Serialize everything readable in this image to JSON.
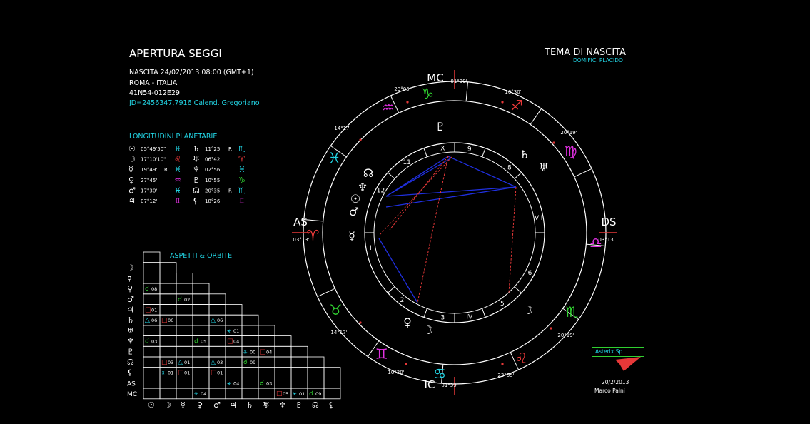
{
  "header": {
    "title": "APERTURA SEGGI",
    "birth_line": "NASCITA 24/02/2013 08:00 (GMT+1)",
    "place": "ROMA - ITALIA",
    "coords": "41N54-012E29",
    "jd_line": "JD=2456347,7916  Calend. Gregoriano"
  },
  "chart_header": {
    "title": "TEMA DI NASCITA",
    "subtitle": "DOMIFIC. PLACIDO"
  },
  "longitudes": {
    "title": "LONGITUDINI PLANETARIE",
    "left": [
      {
        "planet": "☉",
        "value": "05°49'50\"",
        "r": "",
        "sign": "♓",
        "color": "#22d6e6"
      },
      {
        "planet": "☽",
        "value": "17°10'10\"",
        "r": "",
        "sign": "♌",
        "color": "#e63838"
      },
      {
        "planet": "☿",
        "value": "19°49'",
        "r": "R",
        "sign": "♓",
        "color": "#22d6e6"
      },
      {
        "planet": "♀",
        "value": "27°45'",
        "r": "",
        "sign": "♒",
        "color": "#e030e0"
      },
      {
        "planet": "♂",
        "value": "17°30'",
        "r": "",
        "sign": "♓",
        "color": "#22d6e6"
      },
      {
        "planet": "♃",
        "value": "07°12'",
        "r": "",
        "sign": "♊",
        "color": "#e030e0"
      }
    ],
    "right": [
      {
        "planet": "♄",
        "value": "11°25'",
        "r": "R",
        "sign": "♏",
        "color": "#22d6e6"
      },
      {
        "planet": "♅",
        "value": "06°42'",
        "r": "",
        "sign": "♈",
        "color": "#e63838"
      },
      {
        "planet": "♆",
        "value": "02°56'",
        "r": "",
        "sign": "♓",
        "color": "#22d6e6"
      },
      {
        "planet": "♇",
        "value": "10°55'",
        "r": "",
        "sign": "♑",
        "color": "#30d030"
      },
      {
        "planet": "☊",
        "value": "20°35'",
        "r": "R",
        "sign": "♏",
        "color": "#22d6e6"
      },
      {
        "planet": "⚸",
        "value": "18°26'",
        "r": "",
        "sign": "♊",
        "color": "#e030e0"
      }
    ]
  },
  "aspects": {
    "title": "ASPETTI  &  ORBITE",
    "row_labels": [
      "☽",
      "☿",
      "♀",
      "♂",
      "♃",
      "♄",
      "♅",
      "♆",
      "♇",
      "☊",
      "⚸",
      "AS",
      "MC"
    ],
    "col_labels": [
      "☉",
      "☽",
      "☿",
      "♀",
      "♂",
      "♃",
      "♄",
      "♅",
      "♆",
      "♇",
      "☊",
      "⚸"
    ],
    "cells": [
      {
        "r": 3,
        "c": 0,
        "sym": "☌",
        "orb": "08",
        "color": "#30d030"
      },
      {
        "r": 4,
        "c": 2,
        "sym": "☌",
        "orb": "02",
        "color": "#30d030"
      },
      {
        "r": 5,
        "c": 0,
        "sym": "□",
        "orb": "01",
        "color": "#e63838"
      },
      {
        "r": 6,
        "c": 0,
        "sym": "△",
        "orb": "06",
        "color": "#22d6e6"
      },
      {
        "r": 6,
        "c": 1,
        "sym": "□",
        "orb": "06",
        "color": "#e63838"
      },
      {
        "r": 6,
        "c": 4,
        "sym": "△",
        "orb": "06",
        "color": "#22d6e6"
      },
      {
        "r": 7,
        "c": 5,
        "sym": "⚹",
        "orb": "01",
        "color": "#22d6e6"
      },
      {
        "r": 8,
        "c": 0,
        "sym": "☌",
        "orb": "03",
        "color": "#30d030"
      },
      {
        "r": 8,
        "c": 3,
        "sym": "☌",
        "orb": "05",
        "color": "#30d030"
      },
      {
        "r": 8,
        "c": 5,
        "sym": "□",
        "orb": "04",
        "color": "#e63838"
      },
      {
        "r": 9,
        "c": 6,
        "sym": "⚹",
        "orb": "00",
        "color": "#22d6e6"
      },
      {
        "r": 9,
        "c": 7,
        "sym": "□",
        "orb": "04",
        "color": "#e63838"
      },
      {
        "r": 10,
        "c": 1,
        "sym": "□",
        "orb": "03",
        "color": "#e63838"
      },
      {
        "r": 10,
        "c": 2,
        "sym": "△",
        "orb": "01",
        "color": "#22d6e6"
      },
      {
        "r": 10,
        "c": 4,
        "sym": "△",
        "orb": "03",
        "color": "#22d6e6"
      },
      {
        "r": 10,
        "c": 6,
        "sym": "☌",
        "orb": "09",
        "color": "#30d030"
      },
      {
        "r": 11,
        "c": 1,
        "sym": "⚹",
        "orb": "01",
        "color": "#22d6e6"
      },
      {
        "r": 11,
        "c": 2,
        "sym": "□",
        "orb": "01",
        "color": "#e63838"
      },
      {
        "r": 11,
        "c": 4,
        "sym": "□",
        "orb": "01",
        "color": "#e63838"
      },
      {
        "r": 12,
        "c": 5,
        "sym": "⚹",
        "orb": "04",
        "color": "#22d6e6"
      },
      {
        "r": 12,
        "c": 7,
        "sym": "☌",
        "orb": "03",
        "color": "#30d030"
      },
      {
        "r": 13,
        "c": 3,
        "sym": "⚹",
        "orb": "04",
        "color": "#22d6e6"
      },
      {
        "r": 13,
        "c": 8,
        "sym": "□",
        "orb": "05",
        "color": "#e63838"
      },
      {
        "r": 13,
        "c": 9,
        "sym": "⚹",
        "orb": "01",
        "color": "#22d6e6"
      },
      {
        "r": 13,
        "c": 10,
        "sym": "☌",
        "orb": "09",
        "color": "#30d030"
      }
    ]
  },
  "wheel": {
    "angles": {
      "mc": "MC",
      "ic": "IC",
      "as": "AS",
      "ds": "DS"
    },
    "angle_degrees": {
      "mc": "01°39'",
      "ic": "01°39'",
      "as": "03°13'",
      "ds": "03°13'"
    },
    "cusp_degrees": [
      "23°05'",
      "10°30'",
      "14°17'",
      "20°19'",
      "14°17'",
      "20°19'",
      "10°30'",
      "23°05'"
    ],
    "house_numbers": [
      "I",
      "2",
      "3",
      "IV",
      "5",
      "6",
      "VII",
      "8",
      "9",
      "X",
      "11",
      "12"
    ],
    "signs": [
      {
        "glyph": "♑",
        "color": "#30d030"
      },
      {
        "glyph": "♐",
        "color": "#e63838"
      },
      {
        "glyph": "♍",
        "color": "#e030e0"
      },
      {
        "glyph": "♎",
        "color": "#e030e0"
      },
      {
        "glyph": "♏",
        "color": "#30d030"
      },
      {
        "glyph": "♌",
        "color": "#e63838"
      },
      {
        "glyph": "♋",
        "color": "#22d6e6"
      },
      {
        "glyph": "♊",
        "color": "#e030e0"
      },
      {
        "glyph": "♉",
        "color": "#30d030"
      },
      {
        "glyph": "♈",
        "color": "#e63838"
      },
      {
        "glyph": "♓",
        "color": "#22d6e6"
      },
      {
        "glyph": "♒",
        "color": "#e030e0"
      }
    ],
    "planets": [
      "♇",
      "♄",
      "♅",
      "☊",
      "♆",
      "☉",
      "♂",
      "☿",
      "♀",
      "☽",
      "♃",
      "⚸"
    ]
  },
  "footer": {
    "legend_label": "Asterix Sp",
    "date": "20/2/2013",
    "author": "Marco Palni"
  },
  "colors": {
    "cyan": "#22d6e6",
    "red": "#e63838",
    "magenta": "#e030e0",
    "green": "#30d030",
    "blue": "#2030e0"
  }
}
